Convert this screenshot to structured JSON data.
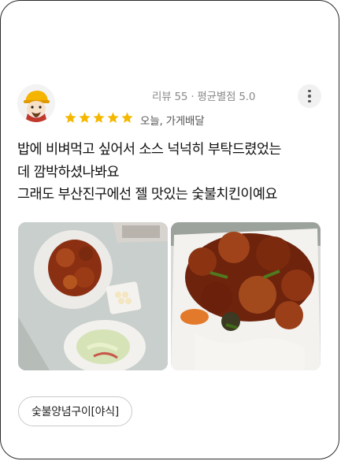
{
  "review": {
    "stats": {
      "review_count_label": "리뷰 55",
      "separator": "·",
      "avg_rating_label": "평균별점 5.0"
    },
    "rating": 5,
    "star_color": "#f5b800",
    "sub_info": "오늘, 가게배달",
    "text_lines": [
      "밥에 비벼먹고 싶어서 소스 넉넉히 부탁드렸었는",
      "데 깜박하셨나봐요",
      "그래도 부산진구에선 젤 맛있는 숯불치킨이예요"
    ],
    "photos": [
      "photo-chicken-table",
      "photo-chicken-box"
    ],
    "menu_tag": "숯불양념구이[야식]"
  },
  "icons": {
    "avatar": "profile-avatar",
    "more": "more-vertical-icon",
    "star": "star-icon"
  }
}
